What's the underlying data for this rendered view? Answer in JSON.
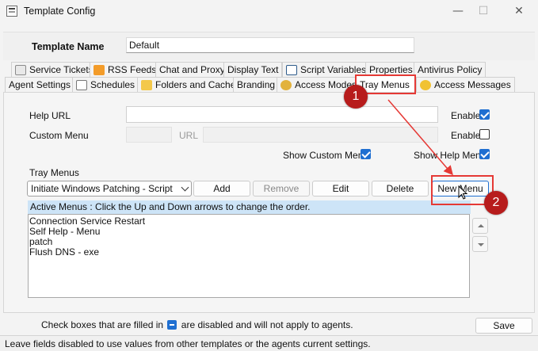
{
  "window": {
    "title": "Template Config",
    "minimize_glyph": "—",
    "maximize_glyph": "☐",
    "close_glyph": "✕"
  },
  "template_name": {
    "label": "Template Name",
    "value": "Default"
  },
  "tabs_row1": [
    {
      "label": "Service Tickets",
      "icon": "ticket-icon"
    },
    {
      "label": "RSS Feeds",
      "icon": "rss-icon"
    },
    {
      "label": "Chat and Proxy",
      "icon": ""
    },
    {
      "label": "Display Text",
      "icon": ""
    },
    {
      "label": "Script Variables",
      "icon": "script-icon"
    },
    {
      "label": "Properties",
      "icon": ""
    },
    {
      "label": "Antivirus Policy",
      "icon": ""
    }
  ],
  "tabs_row2": [
    {
      "label": "Agent Settings",
      "icon": ""
    },
    {
      "label": "Schedules",
      "icon": "calendar-icon"
    },
    {
      "label": "Folders and Cache",
      "icon": "folder-icon"
    },
    {
      "label": "Branding",
      "icon": ""
    },
    {
      "label": "Access Modes",
      "icon": "access-modes-icon"
    },
    {
      "label": "Tray Menus",
      "icon": "",
      "active": true
    },
    {
      "label": "Access Messages",
      "icon": "message-icon"
    }
  ],
  "form": {
    "help_url_label": "Help URL",
    "help_url_value": "",
    "help_url_enable_label": "Enable",
    "help_url_enabled": true,
    "custom_menu_label": "Custom Menu",
    "custom_menu_url_label": "URL",
    "custom_menu_enable_label": "Enable",
    "custom_menu_enabled": false,
    "show_custom_menu_label": "Show Custom Menu",
    "show_custom_menu_checked": true,
    "show_help_menu_label": "Show Help Menu",
    "show_help_menu_checked": true
  },
  "tray_menus": {
    "label": "Tray Menus",
    "selected": "Initiate Windows Patching - Script",
    "buttons": {
      "add": "Add",
      "remove": "Remove",
      "edit": "Edit",
      "delete": "Delete",
      "new_menu": "New Menu"
    },
    "active_hint": "Active Menus : Click the Up and Down arrows to change the order.",
    "items": [
      "Connection Service Restart",
      "Self Help - Menu",
      "patch",
      "Flush DNS - exe"
    ]
  },
  "footer": {
    "note_before": "Check boxes that are filled in",
    "note_after": "are disabled and will not apply to agents.",
    "save_label": "Save",
    "status": "Leave fields disabled to use values from other templates or the agents current settings."
  },
  "annotations": {
    "marker1": "1",
    "marker2": "2",
    "highlight_color": "#e53935",
    "marker_color": "#b71c1c"
  },
  "colors": {
    "accent": "#1f6fd1",
    "selection_bar": "#cde4f7"
  }
}
